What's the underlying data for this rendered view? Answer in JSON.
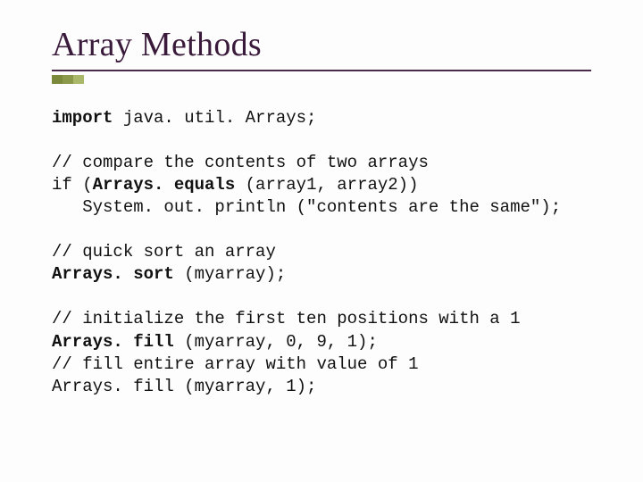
{
  "title": "Array Methods",
  "code": {
    "line1_kw": "import",
    "line1_rest": " java. util. Arrays;",
    "line2": "// compare the contents of two arrays",
    "line3_pre": "if (",
    "line3_bold": "Arrays. equals",
    "line3_post": " (array1, array2))",
    "line4": "   System. out. println (\"contents are the same\");",
    "line5": "// quick sort an array",
    "line6_bold": "Arrays. sort",
    "line6_post": " (myarray);",
    "line7": "// initialize the first ten positions with a 1",
    "line8_bold": "Arrays. fill",
    "line8_post": " (myarray, 0, 9, 1);",
    "line9": "// fill entire array with value of 1",
    "line10": "Arrays. fill (myarray, 1);"
  }
}
